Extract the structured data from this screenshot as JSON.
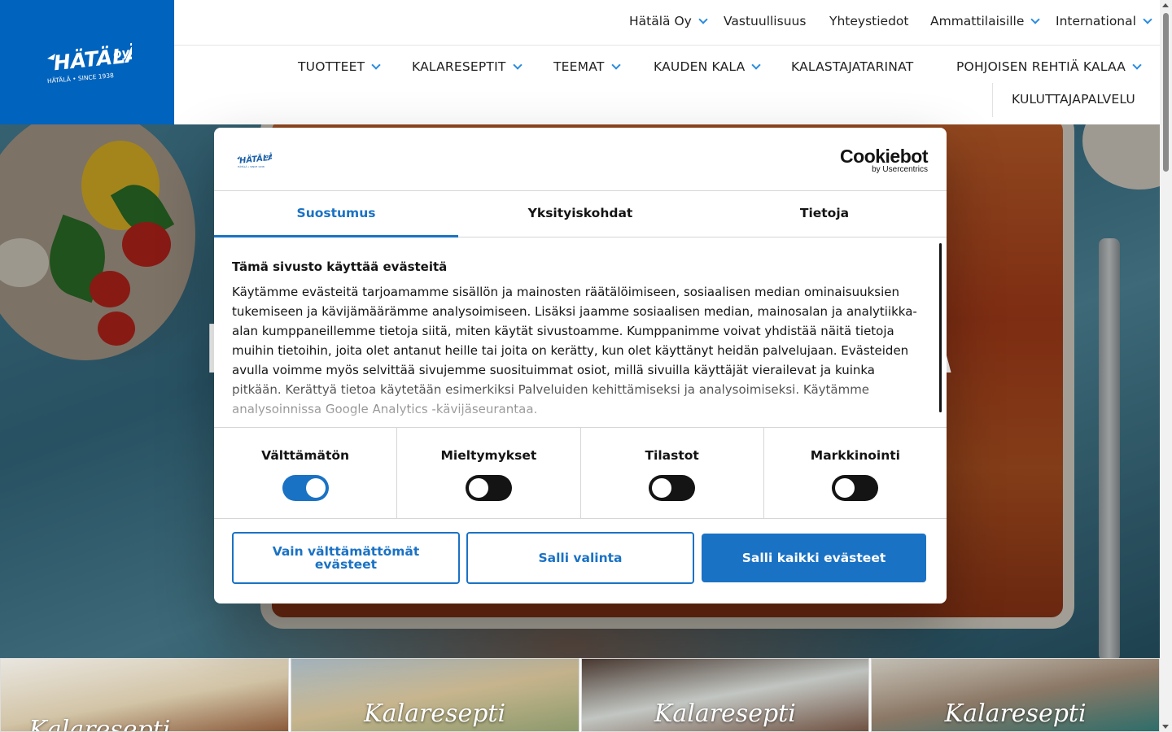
{
  "brand": {
    "logo_text": "HÄTÄLÄ OY",
    "logo_tagline": "HÄTÄLÄ • SINCE 1938",
    "primary_color": "#0063bd",
    "accent_color": "#1a72c4"
  },
  "topnav": [
    {
      "label": "Hätälä Oy",
      "has_dropdown": true
    },
    {
      "label": "Vastuullisuus",
      "has_dropdown": false
    },
    {
      "label": "Yhteystiedot",
      "has_dropdown": false
    },
    {
      "label": "Ammattilaisille",
      "has_dropdown": true
    },
    {
      "label": "International",
      "has_dropdown": true
    }
  ],
  "mainnav": [
    {
      "label": "TUOTTEET",
      "has_dropdown": true
    },
    {
      "label": "KALARESEPTIT",
      "has_dropdown": true
    },
    {
      "label": "TEEMAT",
      "has_dropdown": true
    },
    {
      "label": "KAUDEN KALA",
      "has_dropdown": true
    },
    {
      "label": "KALASTAJATARINAT",
      "has_dropdown": false
    },
    {
      "label": "POHJOISEN REHTIÄ KALAA",
      "has_dropdown": true
    },
    {
      "label": "KULUTTAJAPALVELU",
      "has_dropdown": false
    }
  ],
  "hero": {
    "title_left": "H",
    "title_right": "TA"
  },
  "cards": [
    {
      "label": "Kalaresepti"
    },
    {
      "label": "Kalaresepti"
    },
    {
      "label": "Kalaresepti"
    },
    {
      "label": "Kalaresepti"
    }
  ],
  "cookie_dialog": {
    "provider_name": "Cookiebot",
    "provider_sub": "by Usercentrics",
    "tabs": [
      {
        "label": "Suostumus",
        "active": true
      },
      {
        "label": "Yksityiskohdat",
        "active": false
      },
      {
        "label": "Tietoja",
        "active": false
      }
    ],
    "title": "Tämä sivusto käyttää evästeitä",
    "body": "Käytämme evästeitä tarjoamamme sisällön ja mainosten räätälöimiseen, sosiaalisen median ominaisuuksien tukemiseen ja kävijämäärämme analysoimiseen. Lisäksi jaamme sosiaalisen median, mainosalan ja analytiikka-alan kumppaneillemme tietoja siitä, miten käytät sivustoamme. Kumppanimme voivat yhdistää näitä tietoja muihin tietoihin, joita olet antanut heille tai joita on kerätty, kun olet käyttänyt heidän palvelujaan. Evästeiden avulla voimme myös selvittää sivujemme suosituimmat osiot, millä sivuilla käyttäjät vierailevat ja kuinka pitkään. Kerättyä tietoa käytetään esimerkiksi Palveluiden kehittämiseksi ja analysoimiseksi. Käytämme analysoinnissa Google Analytics -kävijäseurantaa.",
    "toggles": [
      {
        "label": "Välttämätön",
        "on": true
      },
      {
        "label": "Mieltymykset",
        "on": false
      },
      {
        "label": "Tilastot",
        "on": false
      },
      {
        "label": "Markkinointi",
        "on": false
      }
    ],
    "buttons": {
      "necessary_only": "Vain välttämättömät evästeet",
      "allow_selection": "Salli valinta",
      "allow_all": "Salli kaikki evästeet"
    }
  }
}
